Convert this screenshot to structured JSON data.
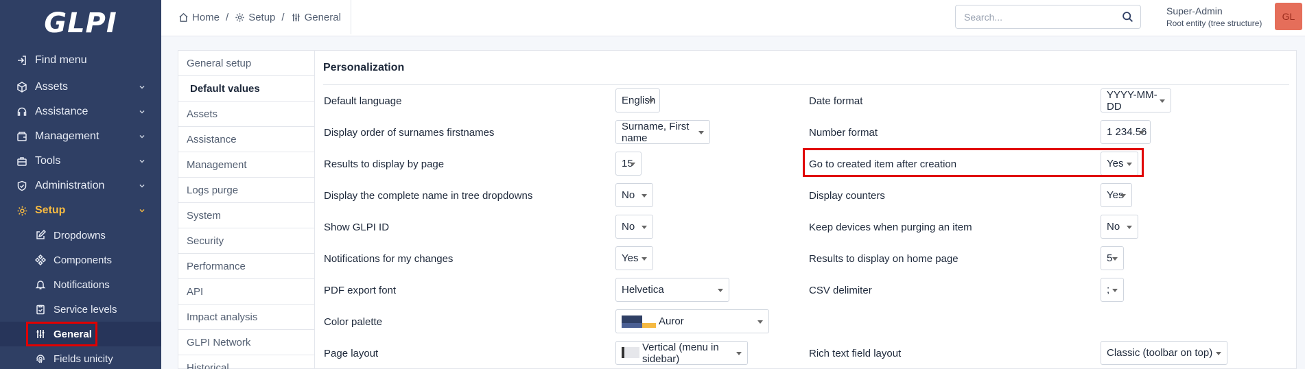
{
  "app": {
    "logo_text": "GLPI"
  },
  "sidebar": {
    "items": [
      {
        "label": "Find menu",
        "icon": "sign-in-icon"
      },
      {
        "label": "Assets",
        "icon": "cube-icon"
      },
      {
        "label": "Assistance",
        "icon": "headset-icon"
      },
      {
        "label": "Management",
        "icon": "wallet-icon"
      },
      {
        "label": "Tools",
        "icon": "briefcase-icon"
      },
      {
        "label": "Administration",
        "icon": "shield-icon"
      },
      {
        "label": "Setup",
        "icon": "gear-icon"
      }
    ],
    "sub_items": [
      {
        "label": "Dropdowns",
        "icon": "edit-icon"
      },
      {
        "label": "Components",
        "icon": "components-icon"
      },
      {
        "label": "Notifications",
        "icon": "bell-icon"
      },
      {
        "label": "Service levels",
        "icon": "clipboard-icon"
      },
      {
        "label": "General",
        "icon": "sliders-icon"
      },
      {
        "label": "Fields unicity",
        "icon": "fingerprint-icon"
      }
    ]
  },
  "header": {
    "breadcrumb": [
      {
        "label": "Home",
        "icon": "home-icon"
      },
      {
        "label": "Setup",
        "icon": "gear-icon"
      },
      {
        "label": "General",
        "icon": "sliders-icon"
      }
    ],
    "breadcrumb_separator": "/",
    "search_placeholder": "Search...",
    "user_name": "Super-Admin",
    "user_entity": "Root entity (tree structure)",
    "avatar_initials": "GL"
  },
  "tabs": [
    "General setup",
    "Default values",
    "Assets",
    "Assistance",
    "Management",
    "Logs purge",
    "System",
    "Security",
    "Performance",
    "API",
    "Impact analysis",
    "GLPI Network",
    "Historical"
  ],
  "panel": {
    "title": "Personalization",
    "left_fields": [
      {
        "label": "Default language",
        "value": "English"
      },
      {
        "label": "Display order of surnames firstnames",
        "value": "Surname, First name"
      },
      {
        "label": "Results to display by page",
        "value": "15"
      },
      {
        "label": "Display the complete name in tree dropdowns",
        "value": "No"
      },
      {
        "label": "Show GLPI ID",
        "value": "No"
      },
      {
        "label": "Notifications for my changes",
        "value": "Yes"
      },
      {
        "label": "PDF export font",
        "value": "Helvetica"
      },
      {
        "label": "Color palette",
        "value": "Auror"
      },
      {
        "label": "Page layout",
        "value": "Vertical (menu in sidebar)"
      }
    ],
    "right_fields": [
      {
        "label": "Date format",
        "value": "YYYY-MM-DD"
      },
      {
        "label": "Number format",
        "value": "1 234.56"
      },
      {
        "label": "Go to created item after creation",
        "value": "Yes"
      },
      {
        "label": "Display counters",
        "value": "Yes"
      },
      {
        "label": "Keep devices when purging an item",
        "value": "No"
      },
      {
        "label": "Results to display on home page",
        "value": "5"
      },
      {
        "label": "CSV delimiter",
        "value": ";"
      },
      {
        "label": "Rich text field layout",
        "value": "Classic (toolbar on top)"
      }
    ]
  },
  "colors": {
    "sidebar_bg": "#2f3f64",
    "active_accent": "#f5b942",
    "highlight_red": "#e00000",
    "palette_dark": "#2f3f64",
    "palette_gold": "#f5b942"
  }
}
